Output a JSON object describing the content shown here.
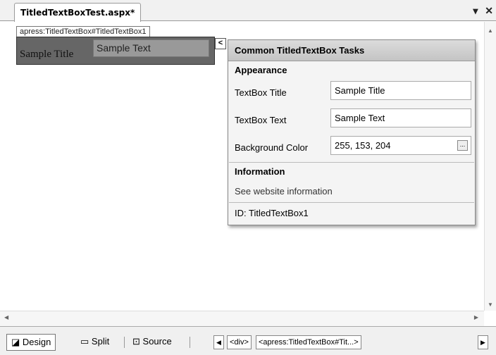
{
  "tab": {
    "title": "TitledTextBoxTest.aspx*"
  },
  "window_buttons": {
    "dropdown": "▾",
    "close": "✕"
  },
  "control": {
    "tag": "apress:TitledTextBox#TitledTextBox1",
    "title": "Sample Title",
    "text": "Sample Text"
  },
  "smarttag": {
    "glyph": "<"
  },
  "tasks": {
    "header": "Common TitledTextBox Tasks",
    "appearance_label": "Appearance",
    "fields": [
      {
        "label": "TextBox Title",
        "value": "Sample Title"
      },
      {
        "label": "TextBox Text",
        "value": "Sample Text"
      },
      {
        "label": "Background Color",
        "value": "255, 153, 204",
        "button": "..."
      }
    ],
    "information_label": "Information",
    "link": "See website information",
    "id": "ID: TitledTextBox1"
  },
  "views": {
    "design": "Design",
    "split": "Split",
    "source": "Source"
  },
  "breadcrumbs": [
    "<div>",
    "<apress:TitledTextBox#Tit...>"
  ],
  "colors": {
    "control_bg": "#666666",
    "panel_header": "#c8c8c8"
  }
}
